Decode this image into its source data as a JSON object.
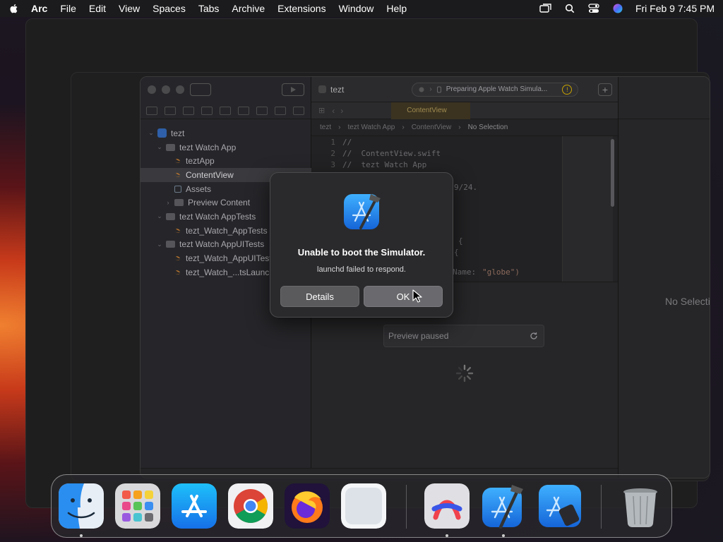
{
  "menubar": {
    "app_name": "Arc",
    "items": [
      "File",
      "Edit",
      "View",
      "Spaces",
      "Tabs",
      "Archive",
      "Extensions",
      "Window",
      "Help"
    ],
    "clock": "Fri Feb 9  7:45 PM"
  },
  "xcode": {
    "scheme_name": "tezt",
    "status_text": "Preparing Apple Watch Simula...",
    "active_tab": "ContentView",
    "jumpbar": {
      "items": [
        "tezt",
        "tezt Watch App",
        "ContentView"
      ],
      "no_selection": "No Selection"
    },
    "navigator": [
      {
        "label": "tezt",
        "kind": "project",
        "indent": 0,
        "disclosure": "open"
      },
      {
        "label": "tezt Watch App",
        "kind": "folder",
        "indent": 1,
        "disclosure": "open"
      },
      {
        "label": "teztApp",
        "kind": "swift",
        "indent": 2,
        "disclosure": ""
      },
      {
        "label": "ContentView",
        "kind": "swift",
        "indent": 2,
        "disclosure": "",
        "selected": true
      },
      {
        "label": "Assets",
        "kind": "assets",
        "indent": 2,
        "disclosure": ""
      },
      {
        "label": "Preview Content",
        "kind": "folder",
        "indent": 2,
        "disclosure": "closed"
      },
      {
        "label": "tezt Watch AppTests",
        "kind": "folder",
        "indent": 1,
        "disclosure": "open"
      },
      {
        "label": "tezt_Watch_AppTests",
        "kind": "swift",
        "indent": 2,
        "disclosure": ""
      },
      {
        "label": "tezt Watch AppUITests",
        "kind": "folder",
        "indent": 1,
        "disclosure": "open"
      },
      {
        "label": "tezt_Watch_AppUITests",
        "kind": "swift",
        "indent": 2,
        "disclosure": ""
      },
      {
        "label": "tezt_Watch_...tsLaunchTests",
        "kind": "swift",
        "indent": 2,
        "disclosure": ""
      }
    ],
    "code_lines": [
      {
        "num": "1",
        "text": "//"
      },
      {
        "num": "2",
        "text": "//  ContentView.swift"
      },
      {
        "num": "3",
        "text": "//  tezt Watch App"
      }
    ],
    "code_fragments": {
      "date_fragment": "9/24.",
      "brace_1": "{",
      "brace_2": "{",
      "system_name": "Name: ",
      "globe_string": "\"globe\")"
    },
    "preview_status": "Preview paused",
    "inspector_placeholder": "No Selection"
  },
  "alert": {
    "title": "Unable to boot the Simulator.",
    "message": "launchd failed to respond.",
    "details_label": "Details",
    "ok_label": "OK"
  },
  "dock": {
    "apps": [
      {
        "name": "Finder",
        "icon": "finder-icon",
        "running": true
      },
      {
        "name": "Launchpad",
        "icon": "launchpad-icon",
        "running": false
      },
      {
        "name": "App Store",
        "icon": "app-store-icon",
        "running": false
      },
      {
        "name": "Google Chrome",
        "icon": "chrome-icon",
        "running": false
      },
      {
        "name": "Firefox",
        "icon": "firefox-icon",
        "running": false
      },
      {
        "name": "Preview",
        "icon": "blank-app-icon",
        "running": false
      },
      {
        "name": "Arc",
        "icon": "arc-icon",
        "running": true
      },
      {
        "name": "Xcode",
        "icon": "xcode-icon",
        "running": true
      },
      {
        "name": "Simulator",
        "icon": "simulator-icon",
        "running": false
      },
      {
        "name": "Trash",
        "icon": "trash-icon",
        "running": false
      }
    ]
  },
  "colors": {
    "accent_blue": "#1f7ae0",
    "alert_bg": "#2a2a2c",
    "menubar_bg": "#1b1b1d"
  }
}
